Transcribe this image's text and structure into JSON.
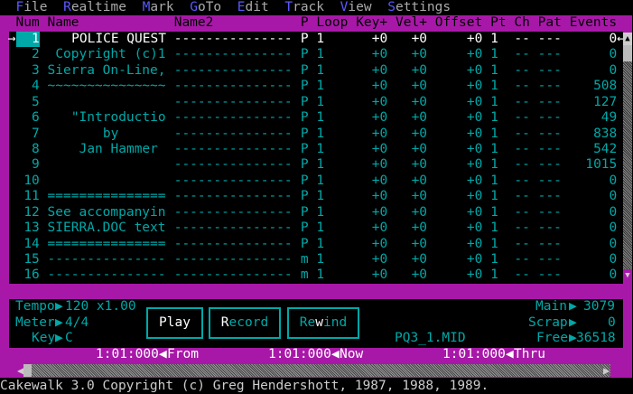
{
  "menu": [
    {
      "hotkey": "F",
      "rest": "ile"
    },
    {
      "hotkey": "R",
      "rest": "ealtime"
    },
    {
      "hotkey": "M",
      "rest": "ark"
    },
    {
      "hotkey": "G",
      "rest": "oTo"
    },
    {
      "hotkey": "E",
      "rest": "dit"
    },
    {
      "hotkey": "T",
      "rest": "rack"
    },
    {
      "hotkey": "V",
      "rest": "iew"
    },
    {
      "hotkey": "S",
      "rest": "ettings"
    }
  ],
  "columns": {
    "num": "Num",
    "name": "Name",
    "name2": "Name2",
    "p": "P",
    "loop": "Loop",
    "key": "Key+",
    "vel": "Vel+",
    "offset": "Offset",
    "pt": "Pt",
    "ch": "Ch",
    "pat": "Pat",
    "events": "Events"
  },
  "tracks": [
    {
      "num": "1",
      "name": "POLICE QUEST",
      "name2": "---------------",
      "p": "P",
      "loop": "1",
      "key": "+0",
      "vel": "+0",
      "offset": "+0",
      "pt": "1",
      "ch": "--",
      "pat": "---",
      "events": "0"
    },
    {
      "num": "2",
      "name": "Copyright (c)1",
      "name2": "---------------",
      "p": "P",
      "loop": "1",
      "key": "+0",
      "vel": "+0",
      "offset": "+0",
      "pt": "1",
      "ch": "--",
      "pat": "---",
      "events": "0"
    },
    {
      "num": "3",
      "name": "Sierra On-Line,",
      "name2": "---------------",
      "p": "P",
      "loop": "1",
      "key": "+0",
      "vel": "+0",
      "offset": "+0",
      "pt": "1",
      "ch": "--",
      "pat": "---",
      "events": "0"
    },
    {
      "num": "4",
      "name": "~~~~~~~~~~~~~~~",
      "name2": "---------------",
      "p": "P",
      "loop": "1",
      "key": "+0",
      "vel": "+0",
      "offset": "+0",
      "pt": "1",
      "ch": "--",
      "pat": "---",
      "events": "508"
    },
    {
      "num": "5",
      "name": "",
      "name2": "---------------",
      "p": "P",
      "loop": "1",
      "key": "+0",
      "vel": "+0",
      "offset": "+0",
      "pt": "1",
      "ch": "--",
      "pat": "---",
      "events": "127"
    },
    {
      "num": "6",
      "name": "\"Introductio",
      "name2": "---------------",
      "p": "P",
      "loop": "1",
      "key": "+0",
      "vel": "+0",
      "offset": "+0",
      "pt": "1",
      "ch": "--",
      "pat": "---",
      "events": "49"
    },
    {
      "num": "7",
      "name": "by",
      "name2": "---------------",
      "p": "P",
      "loop": "1",
      "key": "+0",
      "vel": "+0",
      "offset": "+0",
      "pt": "1",
      "ch": "--",
      "pat": "---",
      "events": "838"
    },
    {
      "num": "8",
      "name": "Jan Hammer",
      "name2": "---------------",
      "p": "P",
      "loop": "1",
      "key": "+0",
      "vel": "+0",
      "offset": "+0",
      "pt": "1",
      "ch": "--",
      "pat": "---",
      "events": "542"
    },
    {
      "num": "9",
      "name": "",
      "name2": "---------------",
      "p": "P",
      "loop": "1",
      "key": "+0",
      "vel": "+0",
      "offset": "+0",
      "pt": "1",
      "ch": "--",
      "pat": "---",
      "events": "1015"
    },
    {
      "num": "10",
      "name": "",
      "name2": "---------------",
      "p": "P",
      "loop": "1",
      "key": "+0",
      "vel": "+0",
      "offset": "+0",
      "pt": "1",
      "ch": "--",
      "pat": "---",
      "events": "0"
    },
    {
      "num": "11",
      "name": "===============",
      "name2": "---------------",
      "p": "P",
      "loop": "1",
      "key": "+0",
      "vel": "+0",
      "offset": "+0",
      "pt": "1",
      "ch": "--",
      "pat": "---",
      "events": "0"
    },
    {
      "num": "12",
      "name": "See accompanyin",
      "name2": "---------------",
      "p": "P",
      "loop": "1",
      "key": "+0",
      "vel": "+0",
      "offset": "+0",
      "pt": "1",
      "ch": "--",
      "pat": "---",
      "events": "0"
    },
    {
      "num": "13",
      "name": "SIERRA.DOC text",
      "name2": "---------------",
      "p": "P",
      "loop": "1",
      "key": "+0",
      "vel": "+0",
      "offset": "+0",
      "pt": "1",
      "ch": "--",
      "pat": "---",
      "events": "0"
    },
    {
      "num": "14",
      "name": "===============",
      "name2": "---------------",
      "p": "P",
      "loop": "1",
      "key": "+0",
      "vel": "+0",
      "offset": "+0",
      "pt": "1",
      "ch": "--",
      "pat": "---",
      "events": "0"
    },
    {
      "num": "15",
      "name": "---------------",
      "name2": "---------------",
      "p": "m",
      "loop": "1",
      "key": "+0",
      "vel": "+0",
      "offset": "+0",
      "pt": "1",
      "ch": "--",
      "pat": "---",
      "events": "0"
    },
    {
      "num": "16",
      "name": "---------------",
      "name2": "---------------",
      "p": "m",
      "loop": "1",
      "key": "+0",
      "vel": "+0",
      "offset": "+0",
      "pt": "1",
      "ch": "--",
      "pat": "---",
      "events": "0"
    }
  ],
  "panel": {
    "tempo_label": "Tempo",
    "tempo": "120 x1.00",
    "meter_label": "Meter",
    "meter": "4/4",
    "key_label": "Key",
    "key": "C",
    "play": {
      "hotkey": "P",
      "rest": "lay"
    },
    "record": {
      "hotkey": "R",
      "rest": "ecord"
    },
    "rewind": {
      "pre": "Re",
      "hotkey": "w",
      "rest": "ind"
    },
    "filename": "PQ3_1.MID",
    "main_label": "Main",
    "main": "3079",
    "scrap_label": "Scrap",
    "scrap": "0",
    "free_label": "Free",
    "free": "36518"
  },
  "markers": {
    "from": "1:01:000",
    "from_label": "From",
    "now": "1:01:000",
    "now_label": "Now",
    "thru": "1:01:000",
    "thru_label": "Thru"
  },
  "status": "Cakewalk 3.0 Copyright (c) Greg Hendershott, 1987, 1988, 1989.",
  "colors": {
    "teal": "#00a8a8",
    "magenta": "#a818a8",
    "menu_hotkey": "#5a5aff"
  }
}
